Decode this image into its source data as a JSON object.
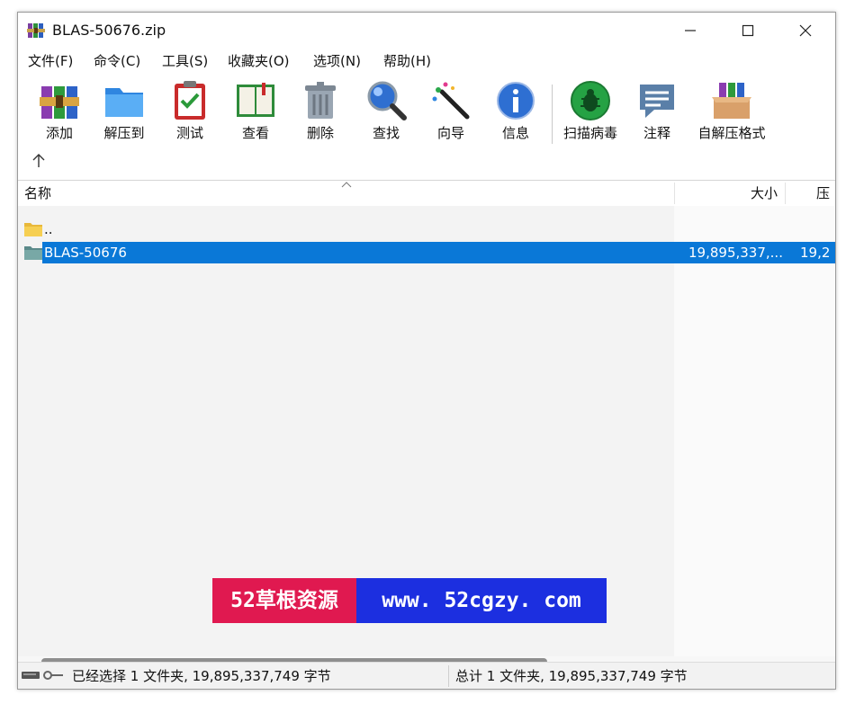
{
  "window": {
    "title": "BLAS-50676.zip"
  },
  "menu": [
    "文件(F)",
    "命令(C)",
    "工具(S)",
    "收藏夹(O)",
    "选项(N)",
    "帮助(H)"
  ],
  "toolbar": {
    "add": "添加",
    "extract_to": "解压到",
    "test": "测试",
    "view": "查看",
    "delete": "删除",
    "find": "查找",
    "wizard": "向导",
    "info": "信息",
    "virus_scan": "扫描病毒",
    "comment": "注释",
    "sfx": "自解压格式",
    "up": "↑"
  },
  "columns": {
    "name": "名称",
    "size": "大小",
    "packed": "压"
  },
  "rows": [
    {
      "name": "..",
      "size": "",
      "packed": ""
    },
    {
      "name": "BLAS-50676",
      "size": "19,895,337,...",
      "packed": "19,2"
    }
  ],
  "watermark": {
    "left": "52草根资源",
    "right": "www. 52cgzy. com"
  },
  "status": {
    "selected": "已经选择 1 文件夹, 19,895,337,749 字节",
    "total": "总计 1 文件夹, 19,895,337,749 字节"
  },
  "colors": {
    "selection": "#0a78d7",
    "watermark_red": "#e01950",
    "watermark_blue": "#1c2fe0"
  }
}
